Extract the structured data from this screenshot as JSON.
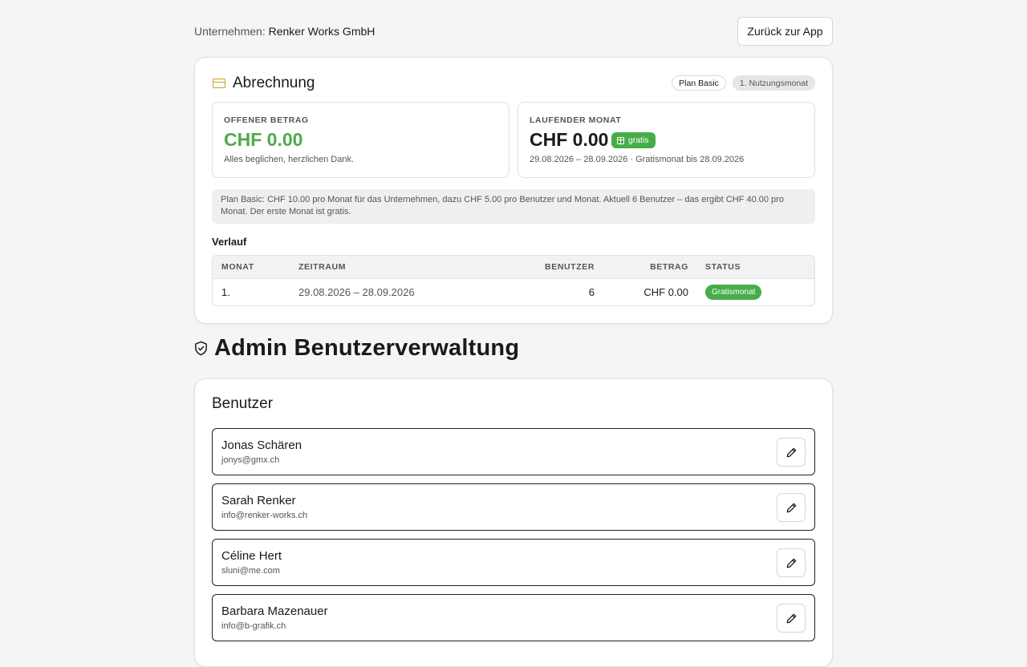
{
  "header": {
    "company_label": "Unternehmen:",
    "company_name": "Renker Works GmbH",
    "back_button": "Zurück zur App"
  },
  "billing": {
    "title": "Abrechnung",
    "plan_pill": "Plan Basic",
    "month_pill": "1. Nutzungsmonat",
    "open": {
      "label": "OFFENER BETRAG",
      "amount": "CHF 0.00",
      "sub": "Alles beglichen, herzlichen Dank."
    },
    "current": {
      "label": "LAUFENDER MONAT",
      "amount": "CHF 0.00",
      "badge": "gratis",
      "sub": "29.08.2026 – 28.09.2026 · Gratismonat bis 28.09.2026"
    },
    "note": "Plan Basic: CHF 10.00 pro Monat für das Unternehmen, dazu CHF 5.00 pro Benutzer und Monat. Aktuell 6 Benutzer – das ergibt CHF 40.00 pro Monat. Der erste Monat ist gratis.",
    "history_title": "Verlauf",
    "table": {
      "headers": {
        "monat": "MONAT",
        "zeitraum": "ZEITRAUM",
        "benutzer": "BENUTZER",
        "betrag": "BETRAG",
        "status": "STATUS"
      },
      "rows": [
        {
          "monat": "1.",
          "zeitraum": "29.08.2026 – 28.09.2026",
          "benutzer": "6",
          "betrag": "CHF 0.00",
          "status": "Gratismonat"
        }
      ]
    },
    "accent_color": "#46ad49",
    "icon": "credit-card-icon"
  },
  "admin": {
    "title": "Admin Benutzerverwaltung",
    "icon": "shield-check-icon",
    "users_title": "Benutzer",
    "users": [
      {
        "name": "Jonas Schären",
        "email": "jonys@gmx.ch"
      },
      {
        "name": "Sarah Renker",
        "email": "info@renker-works.ch"
      },
      {
        "name": "Céline Hert",
        "email": "sluni@me.com"
      },
      {
        "name": "Barbara Mazenauer",
        "email": "info@b-grafik.ch"
      }
    ]
  }
}
